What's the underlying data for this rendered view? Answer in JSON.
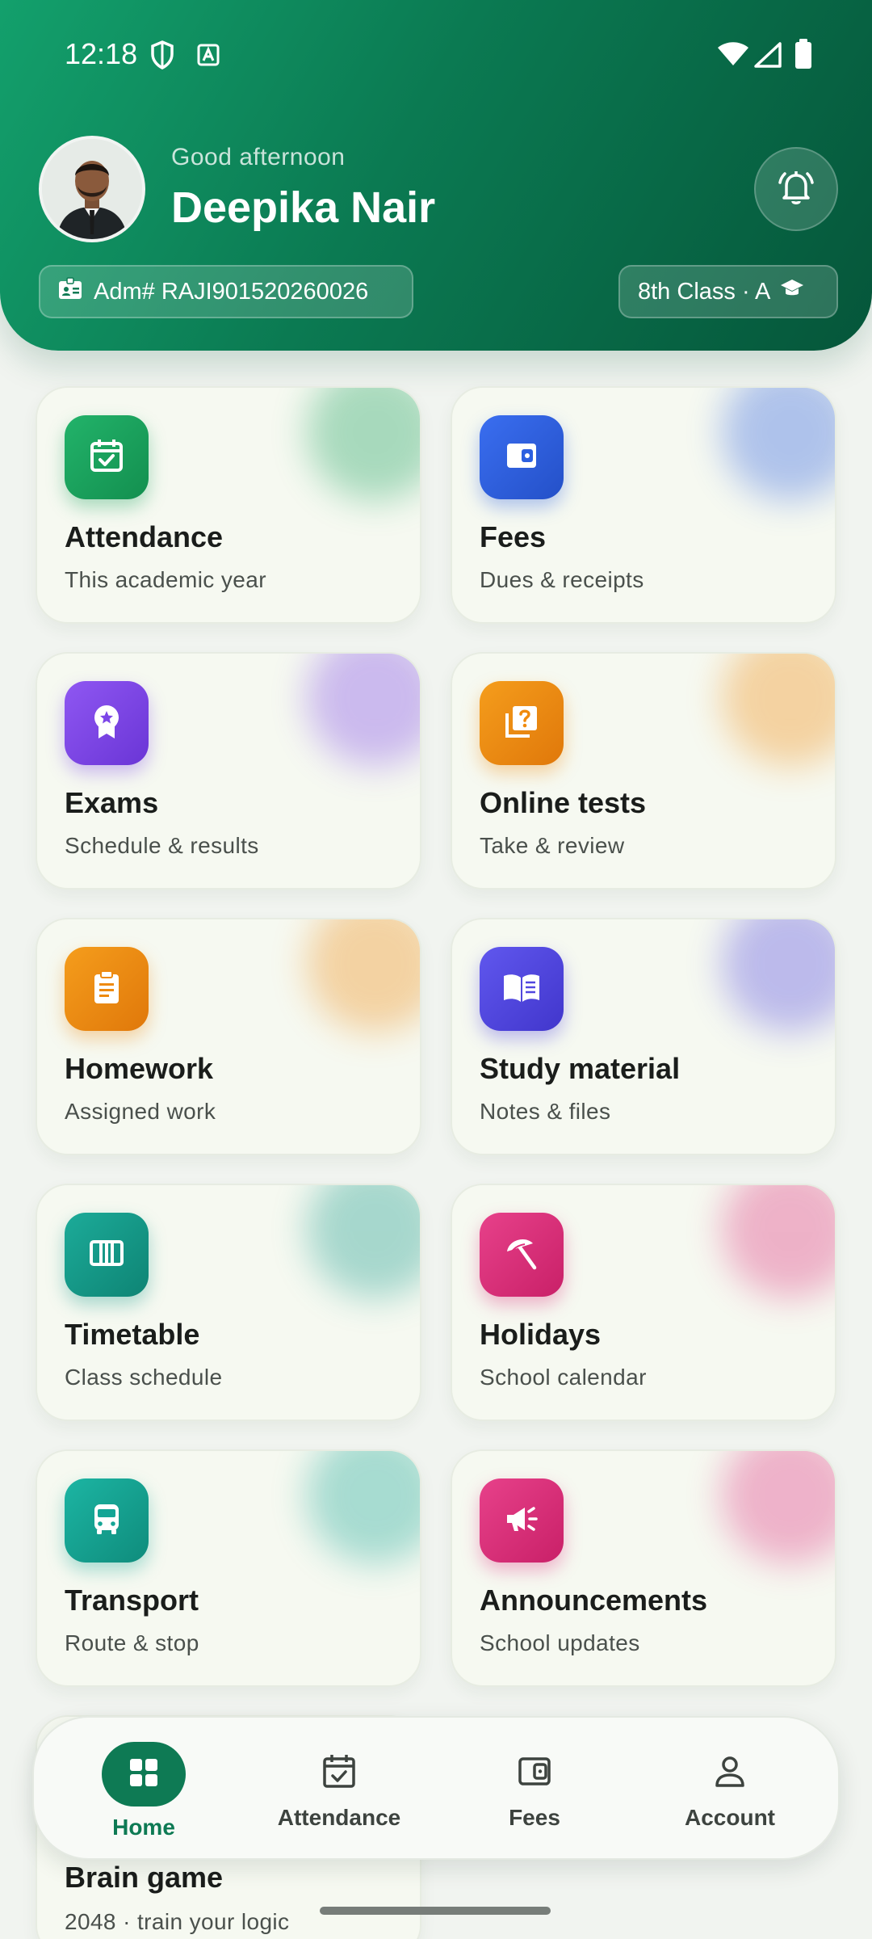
{
  "status_bar": {
    "time": "12:18",
    "icons": [
      "shield-icon",
      "font-a-icon",
      "wifi-icon",
      "cell-signal-icon",
      "battery-icon"
    ]
  },
  "header": {
    "greeting": "Good afternoon",
    "name": "Deepika Nair",
    "admission_label": "Adm# RAJI901520260026",
    "class_label": "8th Class · A",
    "colors": {
      "gradient_start": "#13a06c",
      "gradient_end": "#05563a"
    }
  },
  "tiles": [
    {
      "title": "Attendance",
      "subtitle": "This academic year",
      "icon": "calendar-check-icon",
      "color": "#18a05c"
    },
    {
      "title": "Fees",
      "subtitle": "Dues & receipts",
      "icon": "wallet-icon",
      "color": "#2c5fe0"
    },
    {
      "title": "Exams",
      "subtitle": "Schedule & results",
      "icon": "award-ribbon-icon",
      "color": "#7c45e8"
    },
    {
      "title": "Online tests",
      "subtitle": "Take & review",
      "icon": "question-cards-icon",
      "color": "#f08a0c"
    },
    {
      "title": "Homework",
      "subtitle": "Assigned work",
      "icon": "clipboard-icon",
      "color": "#ee8a10"
    },
    {
      "title": "Study material",
      "subtitle": "Notes & files",
      "icon": "open-book-icon",
      "color": "#5046e0"
    },
    {
      "title": "Timetable",
      "subtitle": "Class schedule",
      "icon": "columns-icon",
      "color": "#13998a"
    },
    {
      "title": "Holidays",
      "subtitle": "School calendar",
      "icon": "beach-umbrella-icon",
      "color": "#de2f7c"
    },
    {
      "title": "Transport",
      "subtitle": "Route & stop",
      "icon": "bus-icon",
      "color": "#14a595"
    },
    {
      "title": "Announcements",
      "subtitle": "School updates",
      "icon": "megaphone-icon",
      "color": "#df2f80"
    },
    {
      "title": "Brain game",
      "subtitle": "2048 · train your logic",
      "icon": "",
      "color": "#2f7a56"
    }
  ],
  "bottom_nav": {
    "items": [
      {
        "label": "Home",
        "icon": "grid-icon",
        "active": true
      },
      {
        "label": "Attendance",
        "icon": "calendar-check-icon",
        "active": false
      },
      {
        "label": "Fees",
        "icon": "wallet-icon",
        "active": false
      },
      {
        "label": "Account",
        "icon": "person-icon",
        "active": false
      }
    ],
    "active_color": "#0e7a54"
  }
}
